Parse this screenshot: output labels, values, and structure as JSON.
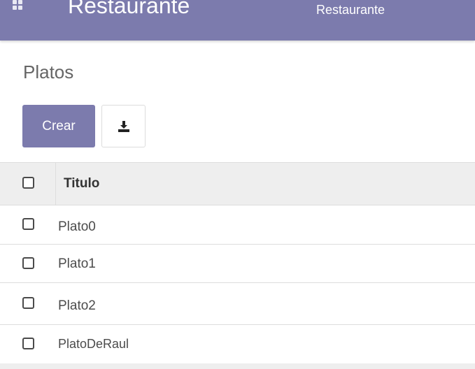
{
  "navbar": {
    "app_title": "Restaurante",
    "menu_items": [
      "Restaurante"
    ],
    "apps_icon": "grid-icon",
    "color": "#7c7bad"
  },
  "breadcrumb": "Platos",
  "toolbar": {
    "create_label": "Crear",
    "export_icon": "download-icon"
  },
  "table": {
    "columns": [
      "Titulo"
    ],
    "rows": [
      {
        "titulo": "Plato0"
      },
      {
        "titulo": "Plato1"
      },
      {
        "titulo": "Plato2"
      },
      {
        "titulo": "PlatoDeRaul"
      }
    ]
  }
}
